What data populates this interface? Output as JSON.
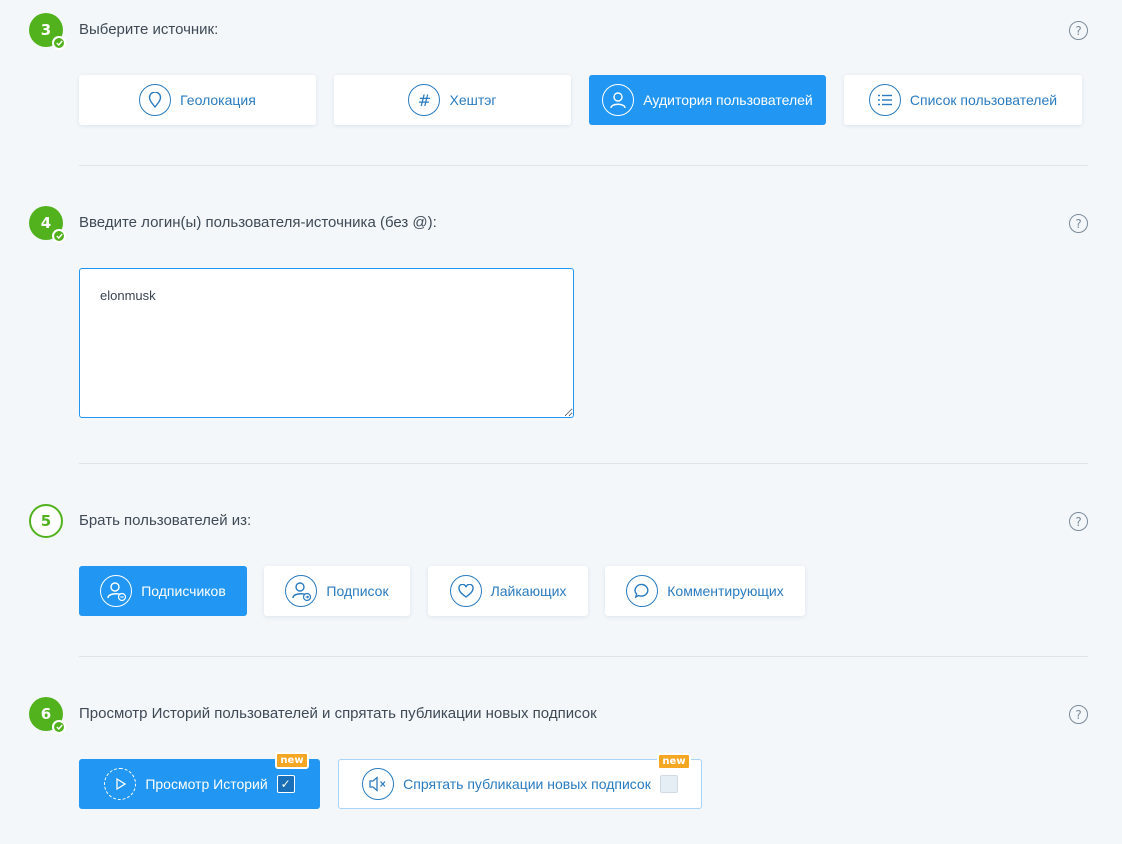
{
  "step3": {
    "number": "3",
    "title": "Выберите источник:",
    "help": "?",
    "options": [
      {
        "label": "Геолокация",
        "icon": "location-pin-icon"
      },
      {
        "label": "Хештэг",
        "icon": "hashtag-icon"
      },
      {
        "label": "Аудитория пользователей",
        "icon": "user-icon"
      },
      {
        "label": "Список пользователей",
        "icon": "list-icon"
      }
    ],
    "selected": "Аудитория пользователей"
  },
  "step4": {
    "number": "4",
    "title": "Введите логин(ы) пользователя-источника (без @):",
    "help": "?",
    "logins_value": "elonmusk"
  },
  "step5": {
    "number": "5",
    "title": "Брать пользователей из:",
    "help": "?",
    "options": [
      {
        "label": "Подписчиков",
        "icon": "follower-user-icon"
      },
      {
        "label": "Подписок",
        "icon": "following-user-icon"
      },
      {
        "label": "Лайкающих",
        "icon": "heart-icon"
      },
      {
        "label": "Комментирующих",
        "icon": "comment-icon"
      }
    ],
    "selected": "Подписчиков"
  },
  "step6": {
    "number": "6",
    "title": "Просмотр Историй пользователей и спрятать публикации новых подписок",
    "help": "?",
    "stories": {
      "label": "Просмотр Историй",
      "badge": "new",
      "checked": true,
      "icon": "play-icon"
    },
    "hide_posts": {
      "label": "Спрятать публикации новых подписок",
      "badge": "new",
      "checked": false,
      "icon": "mute-icon"
    }
  },
  "colors": {
    "accent": "#2196f3",
    "success": "#52b21e",
    "badge": "#f5a623"
  }
}
